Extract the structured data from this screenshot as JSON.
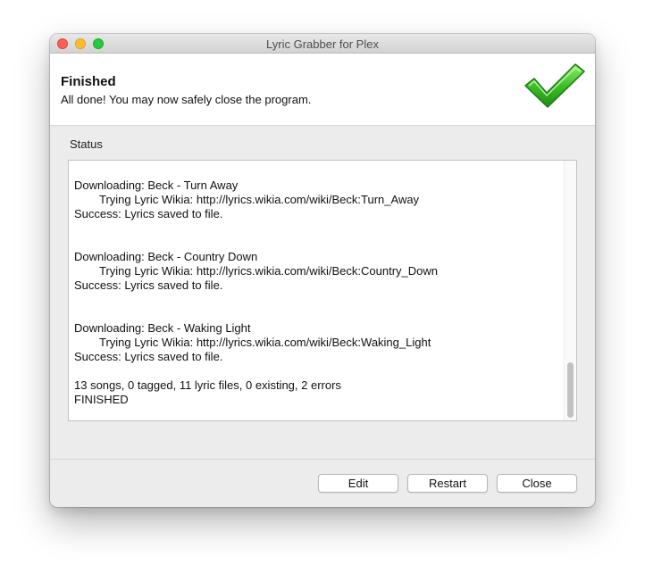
{
  "window": {
    "title": "Lyric Grabber for Plex"
  },
  "header": {
    "title": "Finished",
    "subtitle": "All done! You may now safely close the program.",
    "icon": "checkmark-icon",
    "icon_color": "#3fbf2a"
  },
  "status": {
    "label": "Status",
    "lines": [
      {
        "text": "Downloading: Beck - Turn Away",
        "indent": false
      },
      {
        "text": "Trying Lyric Wikia: http://lyrics.wikia.com/wiki/Beck:Turn_Away",
        "indent": true
      },
      {
        "text": "Success: Lyrics saved to file.",
        "indent": false
      },
      {
        "text": "",
        "blank": true
      },
      {
        "text": "Downloading: Beck - Country Down",
        "indent": false
      },
      {
        "text": "Trying Lyric Wikia: http://lyrics.wikia.com/wiki/Beck:Country_Down",
        "indent": true
      },
      {
        "text": "Success: Lyrics saved to file.",
        "indent": false
      },
      {
        "text": "",
        "blank": true
      },
      {
        "text": "Downloading: Beck - Waking Light",
        "indent": false
      },
      {
        "text": "Trying Lyric Wikia: http://lyrics.wikia.com/wiki/Beck:Waking_Light",
        "indent": true
      },
      {
        "text": "Success: Lyrics saved to file.",
        "indent": false
      },
      {
        "text": "",
        "spacer": true
      },
      {
        "text": "13 songs, 0 tagged, 11 lyric files, 0 existing, 2 errors",
        "indent": false
      },
      {
        "text": "FINISHED",
        "indent": false
      }
    ]
  },
  "buttons": {
    "edit": "Edit",
    "restart": "Restart",
    "close": "Close"
  }
}
